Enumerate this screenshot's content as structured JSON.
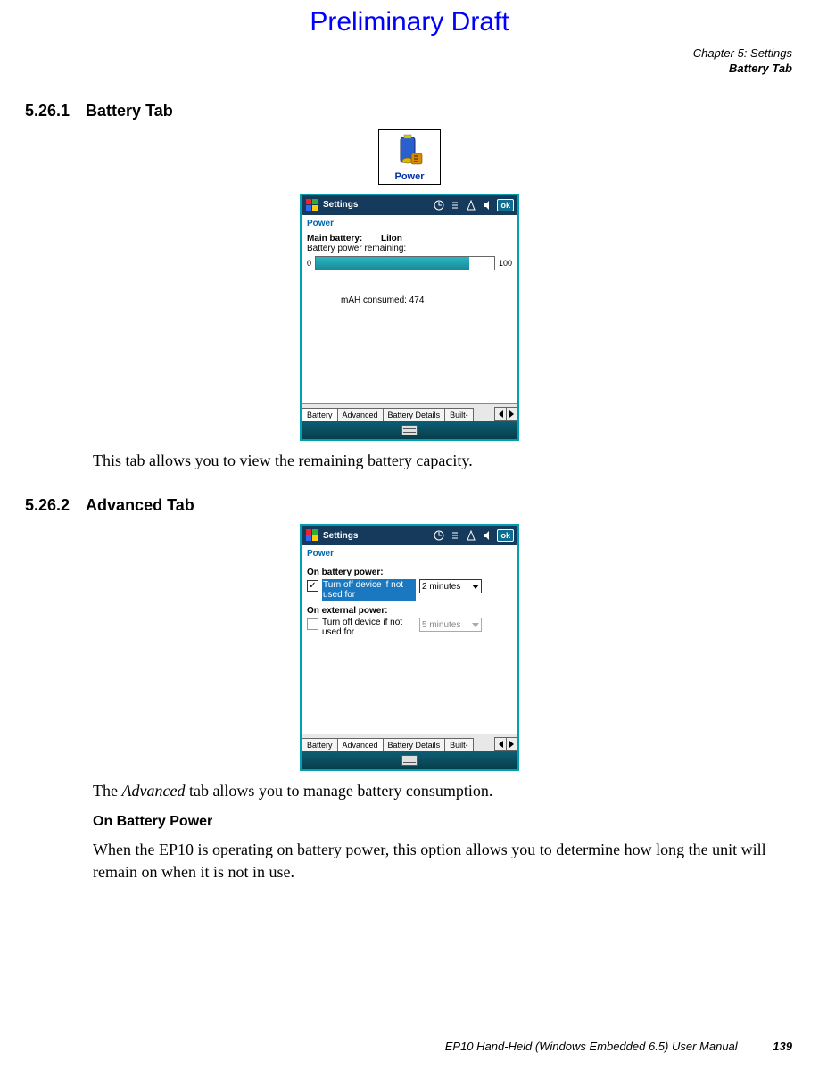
{
  "draft_banner": "Preliminary Draft",
  "chapter_line": "Chapter 5:  Settings",
  "chapter_section": "Battery Tab",
  "sec1": {
    "num": "5.26.1",
    "title": "Battery Tab"
  },
  "power_icon_label": "Power",
  "shot1": {
    "titlebar": "Settings",
    "ok": "ok",
    "app": "Power",
    "main_bat_label": "Main battery:",
    "main_bat_val": "LiIon",
    "remaining": "Battery power remaining:",
    "zero": "0",
    "hundred": "100",
    "mah": "mAH consumed: 474",
    "tabs": [
      "Battery",
      "Advanced",
      "Battery Details",
      "Built-"
    ]
  },
  "sec1_body": "This tab allows you to view the remaining battery capacity.",
  "sec2": {
    "num": "5.26.2",
    "title": "Advanced Tab"
  },
  "shot2": {
    "titlebar": "Settings",
    "ok": "ok",
    "app": "Power",
    "on_batt_label": "On battery power:",
    "on_batt_text": "Turn off device if not used for",
    "on_batt_val": "2 minutes",
    "on_ext_label": "On external power:",
    "on_ext_text": "Turn off device if not used for",
    "on_ext_val": "5 minutes",
    "tabs": [
      "Battery",
      "Advanced",
      "Battery Details",
      "Built-"
    ]
  },
  "sec2_body_pre": "The ",
  "sec2_body_em": "Advanced",
  "sec2_body_post": " tab allows you to manage battery consumption.",
  "sub_heading": "On Battery Power",
  "sub_body": "When the EP10 is operating on battery power, this option allows you to determine how long the unit will remain on when it is not in use.",
  "footer_text": "EP10 Hand-Held (Windows Embedded 6.5) User Manual",
  "footer_page": "139"
}
